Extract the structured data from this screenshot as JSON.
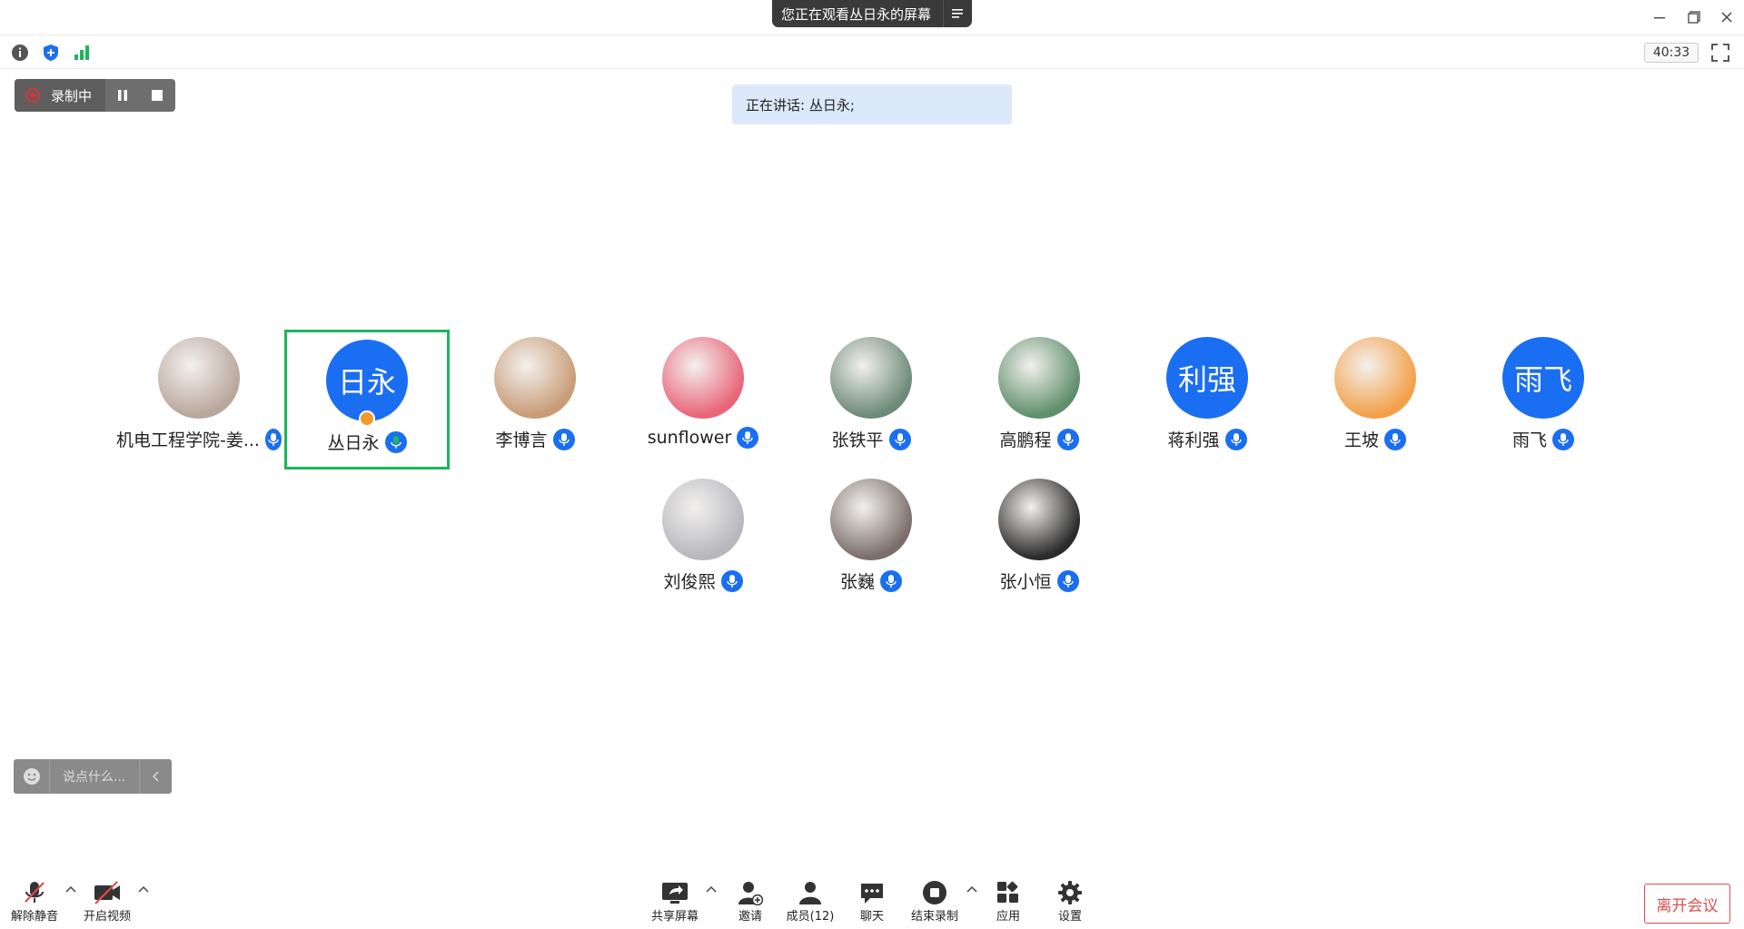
{
  "banner": {
    "text": "您正在观看丛日永的屏幕"
  },
  "toolbar": {
    "timer": "40:33"
  },
  "recording": {
    "label": "录制中"
  },
  "speaking": {
    "text": "正在讲话: 丛日永;"
  },
  "participants": [
    {
      "name": "机电工程学院-姜...",
      "avatar": "photo",
      "color": "#b9a79c"
    },
    {
      "name": "丛日永",
      "avatar": "text",
      "initials": "日永",
      "active": true
    },
    {
      "name": "李博言",
      "avatar": "photo",
      "color": "#c89c76"
    },
    {
      "name": "sunflower",
      "avatar": "photo",
      "color": "#e96579"
    },
    {
      "name": "张铁平",
      "avatar": "photo",
      "color": "#6d8a78"
    },
    {
      "name": "高鹏程",
      "avatar": "photo",
      "color": "#5f8f6b"
    },
    {
      "name": "蒋利强",
      "avatar": "text",
      "initials": "利强"
    },
    {
      "name": "王坡",
      "avatar": "photo",
      "color": "#f3a048"
    },
    {
      "name": "雨飞",
      "avatar": "text",
      "initials": "雨飞"
    },
    {
      "name": "刘俊熙",
      "avatar": "photo",
      "color": "#b7b7bd"
    },
    {
      "name": "张巍",
      "avatar": "photo",
      "color": "#7b6e6a"
    },
    {
      "name": "张小恒",
      "avatar": "photo",
      "color": "#2b2b2b"
    }
  ],
  "chat": {
    "placeholder": "说点什么..."
  },
  "bottom": {
    "unmute": "解除静音",
    "video": "开启视频",
    "share": "共享屏幕",
    "invite": "邀请",
    "members": "成员(12)",
    "chat": "聊天",
    "end_record": "结束录制",
    "apps": "应用",
    "settings": "设置",
    "leave": "离开会议"
  },
  "colors": {
    "accent": "#1a6ef2",
    "active_border": "#1bb75a",
    "leave": "#e24b4b"
  }
}
